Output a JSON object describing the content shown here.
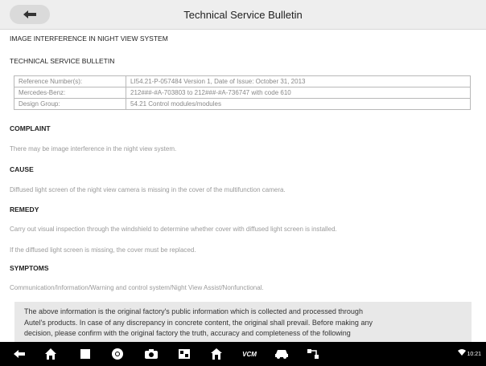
{
  "header": {
    "title": "Technical Service Bulletin"
  },
  "bulletin": {
    "heading": "IMAGE INTERFERENCE IN NIGHT VIEW SYSTEM",
    "subheading": "TECHNICAL SERVICE BULLETIN",
    "table": [
      {
        "label": "Reference Number(s):",
        "value": "LI54.21-P-057484 Version 1, Date of Issue: October 31, 2013"
      },
      {
        "label": "Mercedes-Benz:",
        "value": "212###-#A-703803 to 212###-#A-736747 with code 610"
      },
      {
        "label": "Design Group:",
        "value": "54.21 Control modules/modules"
      }
    ],
    "complaint": {
      "title": "COMPLAINT",
      "text": "There may be image interference in the night view system."
    },
    "cause": {
      "title": "CAUSE",
      "text": "Diffused light screen of the night view camera is missing in the cover of the multifunction camera."
    },
    "remedy": {
      "title": "REMEDY",
      "text1": "Carry out visual inspection through the windshield to determine whether cover with diffused light screen is installed.",
      "text2": "If the diffused light screen is missing, the cover must be replaced."
    },
    "symptoms": {
      "title": "SYMPTOMS",
      "text": "Communication/Information/Warning and control system/Night View Assist/Nonfunctional."
    }
  },
  "notice": {
    "line1": "The above information is the original factory's public information which is collected and processed through",
    "line2": "Autel's products. In case of any discrepancy in concrete content, the original shall prevail. Before making any",
    "line3": "decision, please confirm with the original factory the truth, accuracy and completeness of the following"
  },
  "navbar": {
    "vcm_label": "VCM",
    "status_text": "10:21"
  },
  "colors": {
    "topbar_bg": "#eeeeee",
    "navbar_bg": "#000000",
    "notice_bg": "#e8e8e8"
  },
  "icons": [
    "back-arrow-icon",
    "back-icon",
    "home-icon",
    "recent-apps-icon",
    "chrome-icon",
    "camera-icon",
    "gallery-icon",
    "home-house-icon",
    "vcm-icon",
    "car-icon",
    "network-icon",
    "wifi-icon"
  ]
}
